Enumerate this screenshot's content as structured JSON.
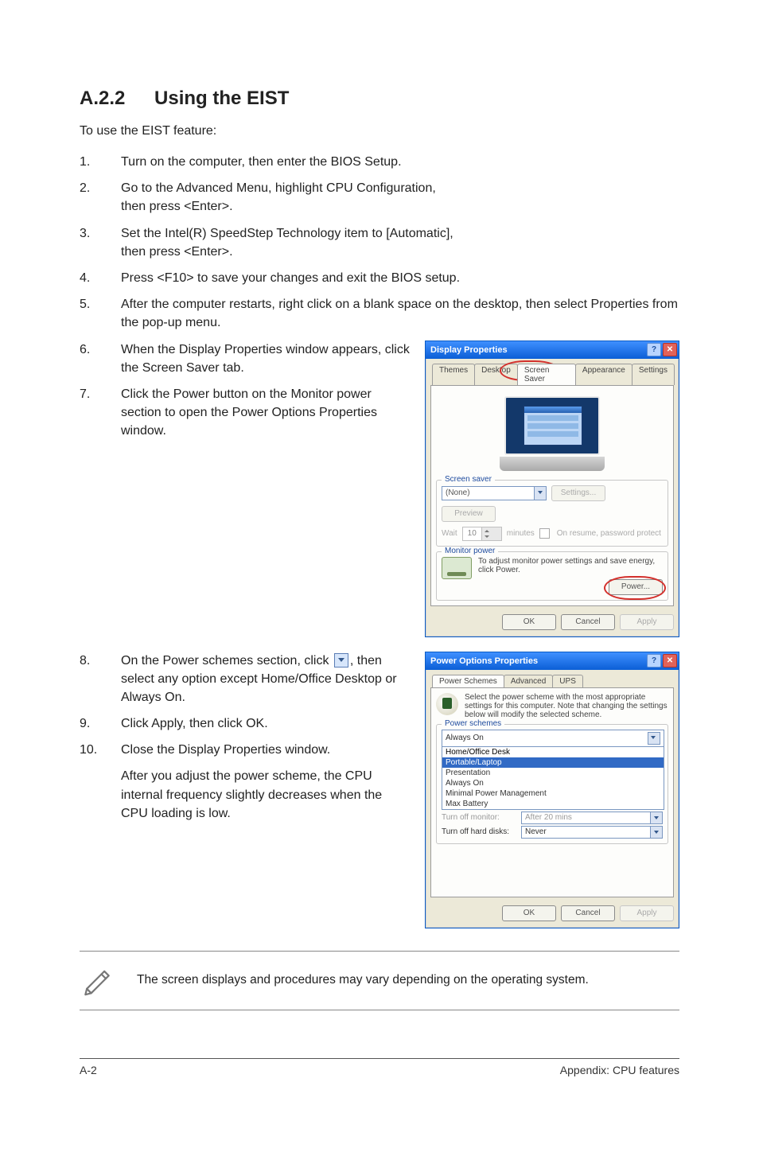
{
  "section": {
    "number": "A.2.2",
    "title": "Using the EIST"
  },
  "intro": "To use the EIST feature:",
  "steps": {
    "s1": "Turn on the computer, then enter the BIOS Setup.",
    "s2a": "Go to the Advanced Menu, highlight CPU Configuration,",
    "s2b": "then press <Enter>.",
    "s3a": "Set the Intel(R) SpeedStep Technology item to [Automatic],",
    "s3b": "then press <Enter>.",
    "s4": "Press <F10> to save your changes and exit the BIOS setup.",
    "s5": "After the computer restarts, right click on a blank space on the desktop, then select Properties from the pop-up menu.",
    "s6": "When the Display Properties window appears, click the Screen Saver tab.",
    "s7": "Click the Power button on the Monitor power section to open the Power Options Properties window.",
    "s8a": "On the Power schemes section, click ",
    "s8b": ", then select any option except Home/Office Desktop or Always On.",
    "s9": "Click Apply, then click OK.",
    "s10": "Close the Display Properties window.",
    "s10_after": "After you adjust the power scheme, the CPU internal frequency slightly decreases when the CPU loading is low."
  },
  "note": "The screen displays and procedures may vary depending on the operating system.",
  "footer": {
    "left": "A-2",
    "right": "Appendix: CPU features"
  },
  "displayDialog": {
    "title": "Display Properties",
    "tabs": {
      "themes": "Themes",
      "desktop": "Desktop",
      "screensaver": "Screen Saver",
      "appearance": "Appearance",
      "settings": "Settings"
    },
    "groupScreensaver": "Screen saver",
    "ssValue": "(None)",
    "settingsBtn": "Settings...",
    "previewBtn": "Preview",
    "waitLabel": "Wait",
    "waitValue": "10",
    "minutesLabel": "minutes",
    "onResume": "On resume, password protect",
    "groupMonitor": "Monitor power",
    "monitorText": "To adjust monitor power settings and save energy, click Power.",
    "powerBtn": "Power...",
    "ok": "OK",
    "cancel": "Cancel",
    "apply": "Apply"
  },
  "powerDialog": {
    "title": "Power Options Properties",
    "tabs": {
      "schemes": "Power Schemes",
      "advanced": "Advanced",
      "ups": "UPS"
    },
    "desc": "Select the power scheme with the most appropriate settings for this computer. Note that changing the settings below will modify the selected scheme.",
    "groupSchemes": "Power schemes",
    "selected": "Always On",
    "options": {
      "o1": "Home/Office Desk",
      "o2": "Portable/Laptop",
      "o3": "Presentation",
      "o4": "Always On",
      "o5": "Minimal Power Management",
      "o6": "Max Battery"
    },
    "row1": {
      "label": "Turn off monitor:",
      "value": "After 20 mins"
    },
    "row2": {
      "label": "Turn off hard disks:",
      "value": "Never"
    },
    "ok": "OK",
    "cancel": "Cancel",
    "apply": "Apply"
  }
}
